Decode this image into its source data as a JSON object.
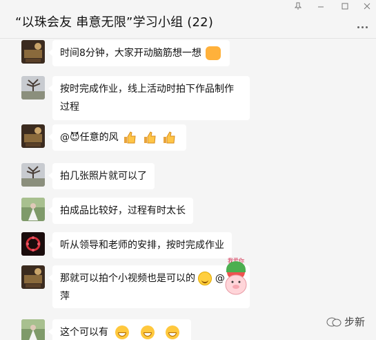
{
  "window": {
    "title": "“以珠会友 串意无限”学习小组 (22)",
    "controls": [
      "pin-icon",
      "minimize-icon",
      "maximize-icon",
      "close-icon"
    ]
  },
  "messages": [
    {
      "text": "时间8分钟，大家开动脑筋想一想",
      "emoji": "fist-icon"
    },
    {
      "text": "按时完成作业，线上活动时拍下作品制作过程"
    },
    {
      "text": "@😈任意的风",
      "emoji": "thumbs-up-icon x3"
    },
    {
      "text": "拍几张照片就可以了"
    },
    {
      "text": "拍成品比较好，过程有时太长"
    },
    {
      "text": "听从领导和老师的安排，按时完成作业"
    },
    {
      "text": "那就可以拍个小视频也是可以的",
      "mention": "@",
      "continuation": "萍",
      "sticker_label": "我爱你"
    },
    {
      "text": "这个可以有",
      "emoji": "grin-icon x3"
    }
  ],
  "watermark": {
    "label": "步新"
  },
  "colors": {
    "background": "#f5f5f5",
    "bubble": "#ffffff",
    "text": "#111111"
  }
}
